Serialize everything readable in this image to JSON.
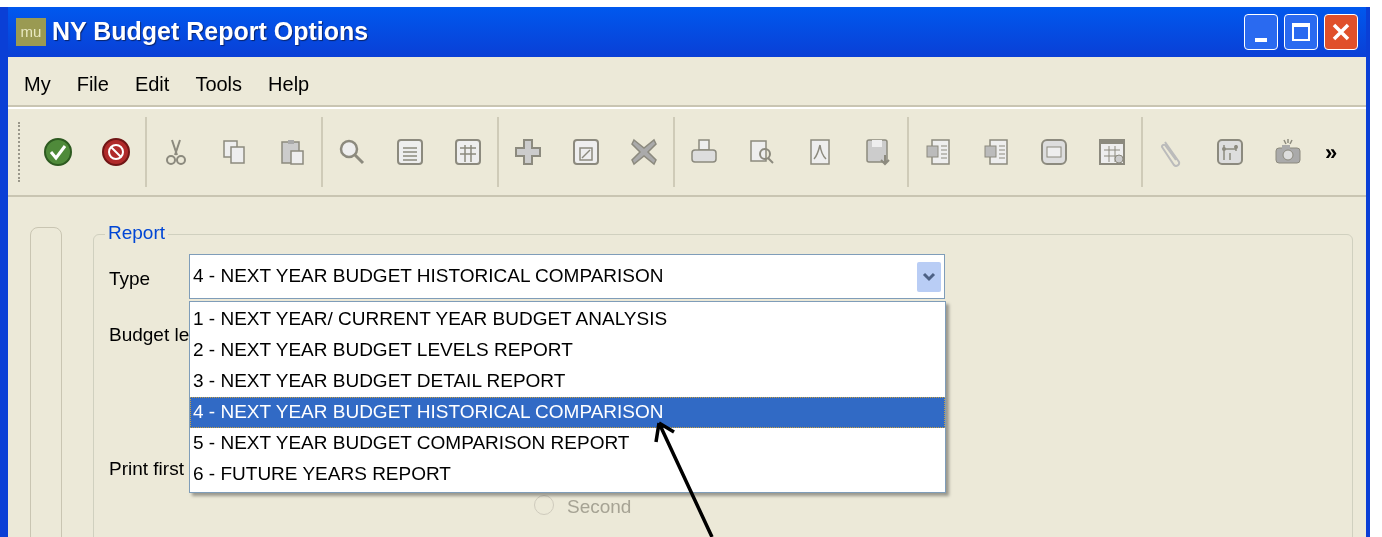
{
  "window": {
    "title": "NY Budget Report Options",
    "app_icon_text": "mu"
  },
  "menu": [
    "My",
    "File",
    "Edit",
    "Tools",
    "Help"
  ],
  "toolbar": {
    "overflow": "»"
  },
  "report": {
    "legend": "Report",
    "fields": [
      {
        "kind": "type",
        "label": "Type"
      },
      {
        "kind": "plain",
        "label": "Budget le"
      },
      {
        "kind": "plain",
        "label": "Print first"
      }
    ],
    "type_combo": {
      "value": "4 - NEXT YEAR BUDGET HISTORICAL COMPARISON",
      "expanded": true,
      "options": [
        {
          "label": "1 - NEXT YEAR/ CURRENT YEAR BUDGET ANALYSIS",
          "selected": false
        },
        {
          "label": "2 - NEXT YEAR BUDGET LEVELS REPORT",
          "selected": false
        },
        {
          "label": "3 - NEXT YEAR BUDGET DETAIL REPORT",
          "selected": false
        },
        {
          "label": "4 - NEXT YEAR BUDGET HISTORICAL COMPARISON",
          "selected": true
        },
        {
          "label": "5 - NEXT YEAR BUDGET COMPARISON REPORT",
          "selected": false
        },
        {
          "label": "6 - FUTURE YEARS REPORT",
          "selected": false
        }
      ]
    },
    "radio": {
      "label": "Second",
      "checked": false,
      "disabled": true
    }
  }
}
